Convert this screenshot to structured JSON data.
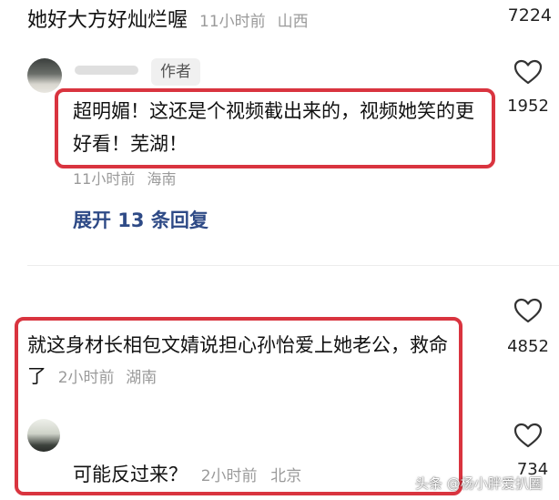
{
  "comment_top": {
    "text": "她好大方好灿烂喔",
    "time": "11小时前",
    "location": "山西",
    "like_count": "7224"
  },
  "comment_author": {
    "badge": "作者",
    "text": "超明媚！这还是个视频截出来的，视频她笑的更好看！芜湖！",
    "time": "11小时前",
    "location": "海南",
    "like_count": "1952",
    "expand_label": "展开 13 条回复"
  },
  "comment_main": {
    "text": "就这身材长相包文婧说担心孙怡爱上她老公，救命了",
    "time": "2小时前",
    "location": "湖南",
    "like_count": "4852"
  },
  "reply": {
    "text": "可能反过来？",
    "time": "2小时前",
    "location": "北京",
    "like_count": "734"
  },
  "watermark": "头条 @杨小胖爱扒圈",
  "icons": {
    "like": "heart-outline-icon"
  },
  "colors": {
    "highlight_border": "#d9343f",
    "expand_link": "#2e4a86",
    "meta_text": "#9a9a9a"
  }
}
